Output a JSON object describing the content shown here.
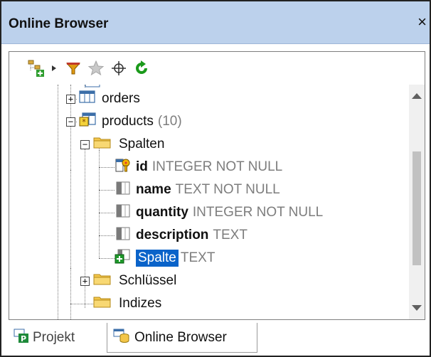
{
  "panel": {
    "title": "Online Browser",
    "close_glyph": "×"
  },
  "toolbar": {
    "items": [
      {
        "icon": "add-connection-icon"
      },
      {
        "icon": "dropdown-arrow-icon"
      },
      {
        "icon": "filter-icon"
      },
      {
        "icon": "favorites-star-icon"
      },
      {
        "icon": "locate-crosshair-icon"
      },
      {
        "icon": "refresh-icon"
      }
    ]
  },
  "tree": {
    "orders": {
      "label": "orders"
    },
    "products": {
      "label": "products",
      "count": "(10)"
    },
    "spalten": {
      "label": "Spalten"
    },
    "columns": [
      {
        "name": "id",
        "type": "INTEGER NOT NULL",
        "icon": "primary-key-column-icon"
      },
      {
        "name": "name",
        "type": "TEXT NOT NULL",
        "icon": "column-icon"
      },
      {
        "name": "quantity",
        "type": "INTEGER NOT NULL",
        "icon": "column-icon"
      },
      {
        "name": "description",
        "type": "TEXT",
        "icon": "column-icon"
      },
      {
        "name": "Spalte",
        "type": "TEXT",
        "icon": "new-column-icon",
        "selected": true
      }
    ],
    "schluessel": {
      "label": "Schlüssel"
    },
    "indizes": {
      "label": "Indizes"
    }
  },
  "tabs": [
    {
      "label": "Projekt",
      "active": false,
      "icon": "project-icon"
    },
    {
      "label": "Online Browser",
      "active": true,
      "icon": "online-browser-icon"
    }
  ],
  "colors": {
    "title_bar": "#bcd1ec",
    "selection": "#0a63c9",
    "muted_text": "#7d7d7d",
    "folder": "#f3c64a"
  }
}
